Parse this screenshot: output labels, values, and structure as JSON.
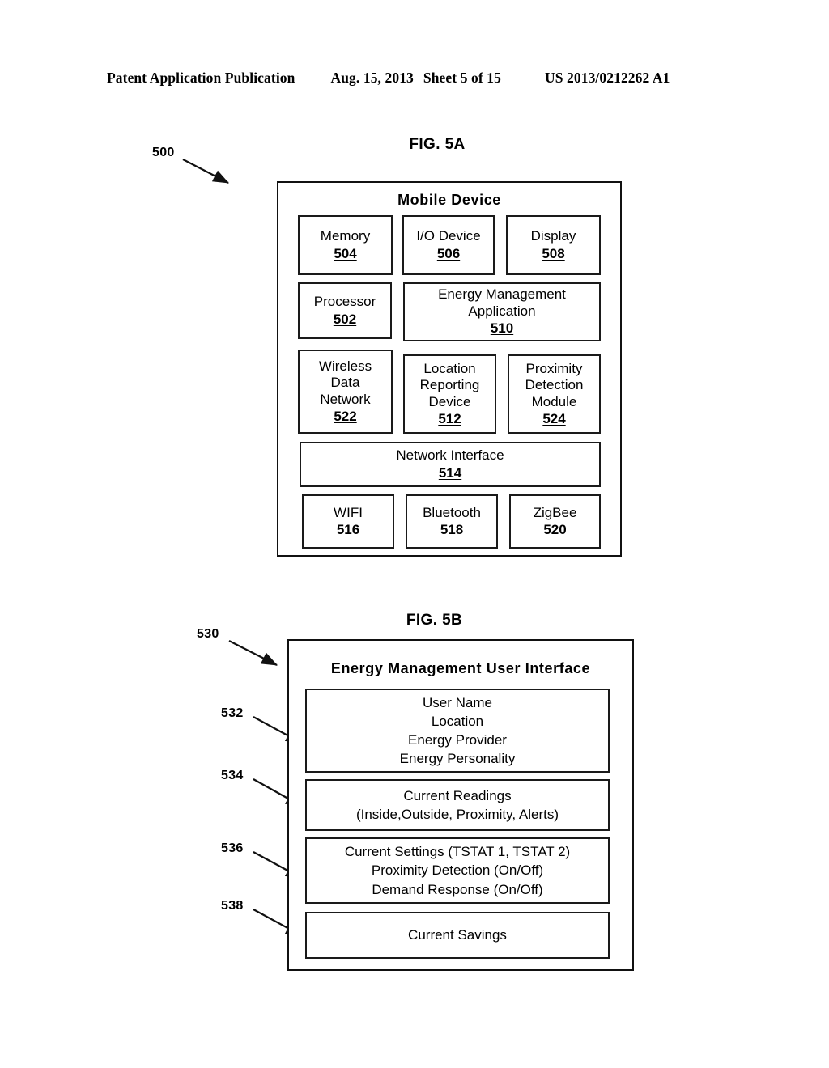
{
  "header": {
    "publication": "Patent Application Publication",
    "date": "Aug. 15, 2013",
    "sheet": "Sheet 5 of 15",
    "patent_number": "US 2013/0212262 A1"
  },
  "figures": [
    {
      "title": "FIG. 5A",
      "ref": "500",
      "container_title": "Mobile Device",
      "blocks": [
        {
          "label": "Memory",
          "number": "504"
        },
        {
          "label": "I/O Device",
          "number": "506"
        },
        {
          "label": "Display",
          "number": "508"
        },
        {
          "label": "Processor",
          "number": "502"
        },
        {
          "label": "Energy Management\nApplication",
          "number": "510"
        },
        {
          "label": "Wireless\nData\nNetwork",
          "number": "522"
        },
        {
          "label": "Location\nReporting\nDevice",
          "number": "512"
        },
        {
          "label": "Proximity\nDetection\nModule",
          "number": "524"
        },
        {
          "label": "Network Interface",
          "number": "514"
        },
        {
          "label": "WIFI",
          "number": "516"
        },
        {
          "label": "Bluetooth",
          "number": "518"
        },
        {
          "label": "ZigBee",
          "number": "520"
        }
      ]
    },
    {
      "title": "FIG. 5B",
      "ref": "530",
      "container_title": "Energy Management  User Interface",
      "panels": [
        {
          "ref": "532",
          "lines": [
            "User Name",
            "Location",
            "Energy Provider",
            "Energy Personality"
          ]
        },
        {
          "ref": "534",
          "lines": [
            "Current Readings",
            "(Inside,Outside, Proximity, Alerts)"
          ]
        },
        {
          "ref": "536",
          "lines": [
            "Current Settings (TSTAT 1, TSTAT 2)",
            "Proximity Detection (On/Off)",
            "Demand Response (On/Off)"
          ]
        },
        {
          "ref": "538",
          "lines": [
            "Current Savings"
          ]
        }
      ]
    }
  ]
}
